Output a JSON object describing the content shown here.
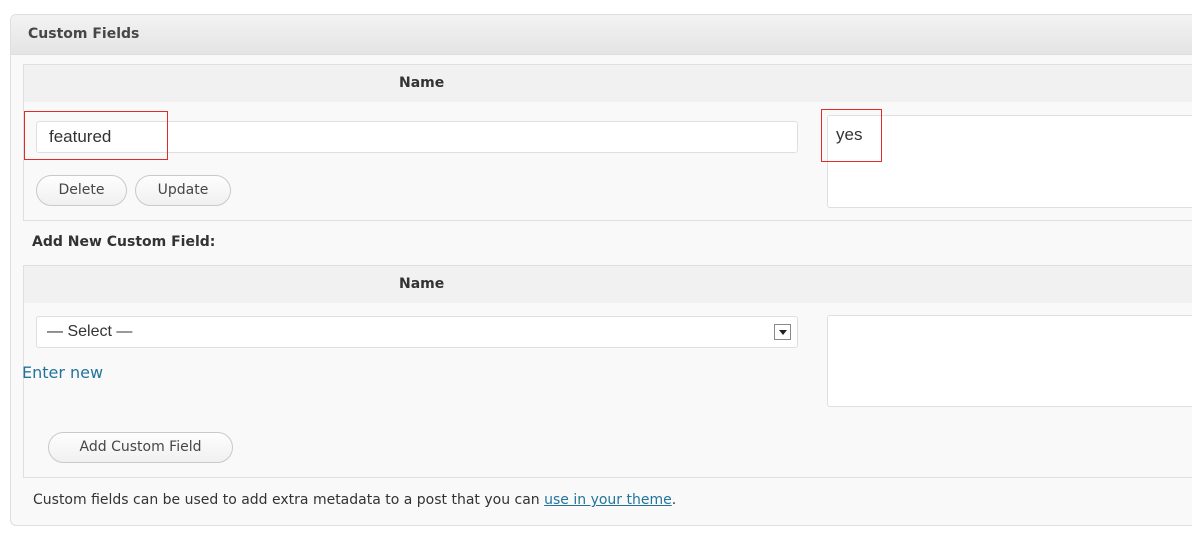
{
  "metabox": {
    "title": "Custom Fields"
  },
  "existing_table": {
    "name_header": "Name",
    "row": {
      "key": "featured",
      "value": "yes",
      "delete_label": "Delete",
      "update_label": "Update"
    }
  },
  "add_new": {
    "heading": "Add New Custom Field:",
    "name_header": "Name",
    "select_value": "— Select —",
    "enter_new_label": "Enter new",
    "value": "",
    "add_button_label": "Add Custom Field"
  },
  "footer_note": {
    "text": "Custom fields can be used to add extra metadata to a post that you can ",
    "link_label": "use in your theme",
    "suffix": "."
  },
  "colors": {
    "highlight": "#e02b2b",
    "link": "#21759b"
  }
}
